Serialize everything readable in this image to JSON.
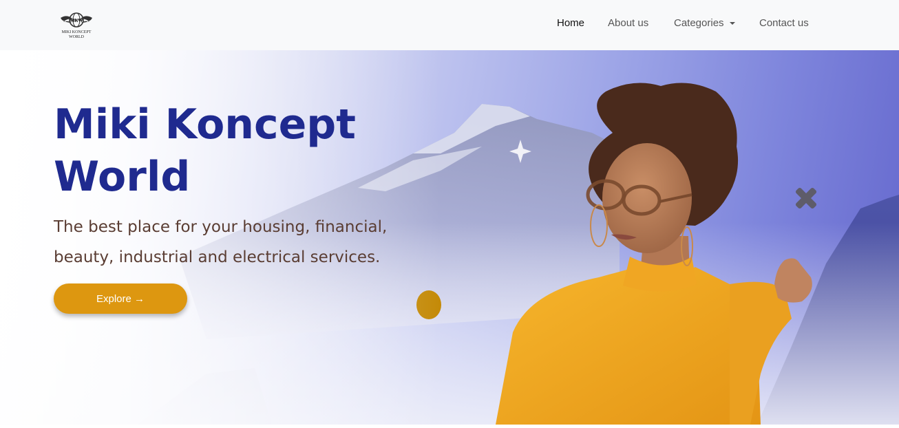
{
  "brand": {
    "logo_initials": "MKW",
    "logo_line1": "MIKI KONCEPT",
    "logo_line2": "WORLD"
  },
  "nav": {
    "items": [
      {
        "label": "Home",
        "active": true
      },
      {
        "label": "About us",
        "active": false
      },
      {
        "label": "Categories",
        "active": false,
        "dropdown": true
      },
      {
        "label": "Contact us",
        "active": false
      }
    ]
  },
  "hero": {
    "title_line1": "Miki Koncept",
    "title_line2": "World",
    "subtitle": "The best place for your housing, financial, beauty, industrial and electrical services.",
    "cta_label": "Explore →"
  },
  "colors": {
    "accent": "#dd9710",
    "title": "#1f2a8f",
    "subtitle": "#5a3d33",
    "sweater": "#f2a61f",
    "hero_gradient_end": "#6467cd"
  },
  "icons": {
    "sparkle": "four-point-star",
    "cross": "x-mark",
    "dot": "circle"
  }
}
